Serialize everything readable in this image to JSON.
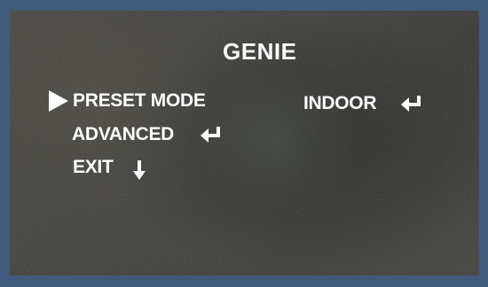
{
  "menu": {
    "title": "GENIE",
    "items": [
      {
        "label": "PRESET MODE",
        "value": "INDOOR",
        "value_icon": "enter-icon",
        "selected": true,
        "cursor_icon": "triangle-right-icon"
      },
      {
        "label": "ADVANCED",
        "icon": "enter-icon"
      },
      {
        "label": "EXIT",
        "icon": "arrow-down-icon"
      }
    ]
  },
  "colors": {
    "frame": "#415a7c",
    "text": "#ffffff"
  }
}
